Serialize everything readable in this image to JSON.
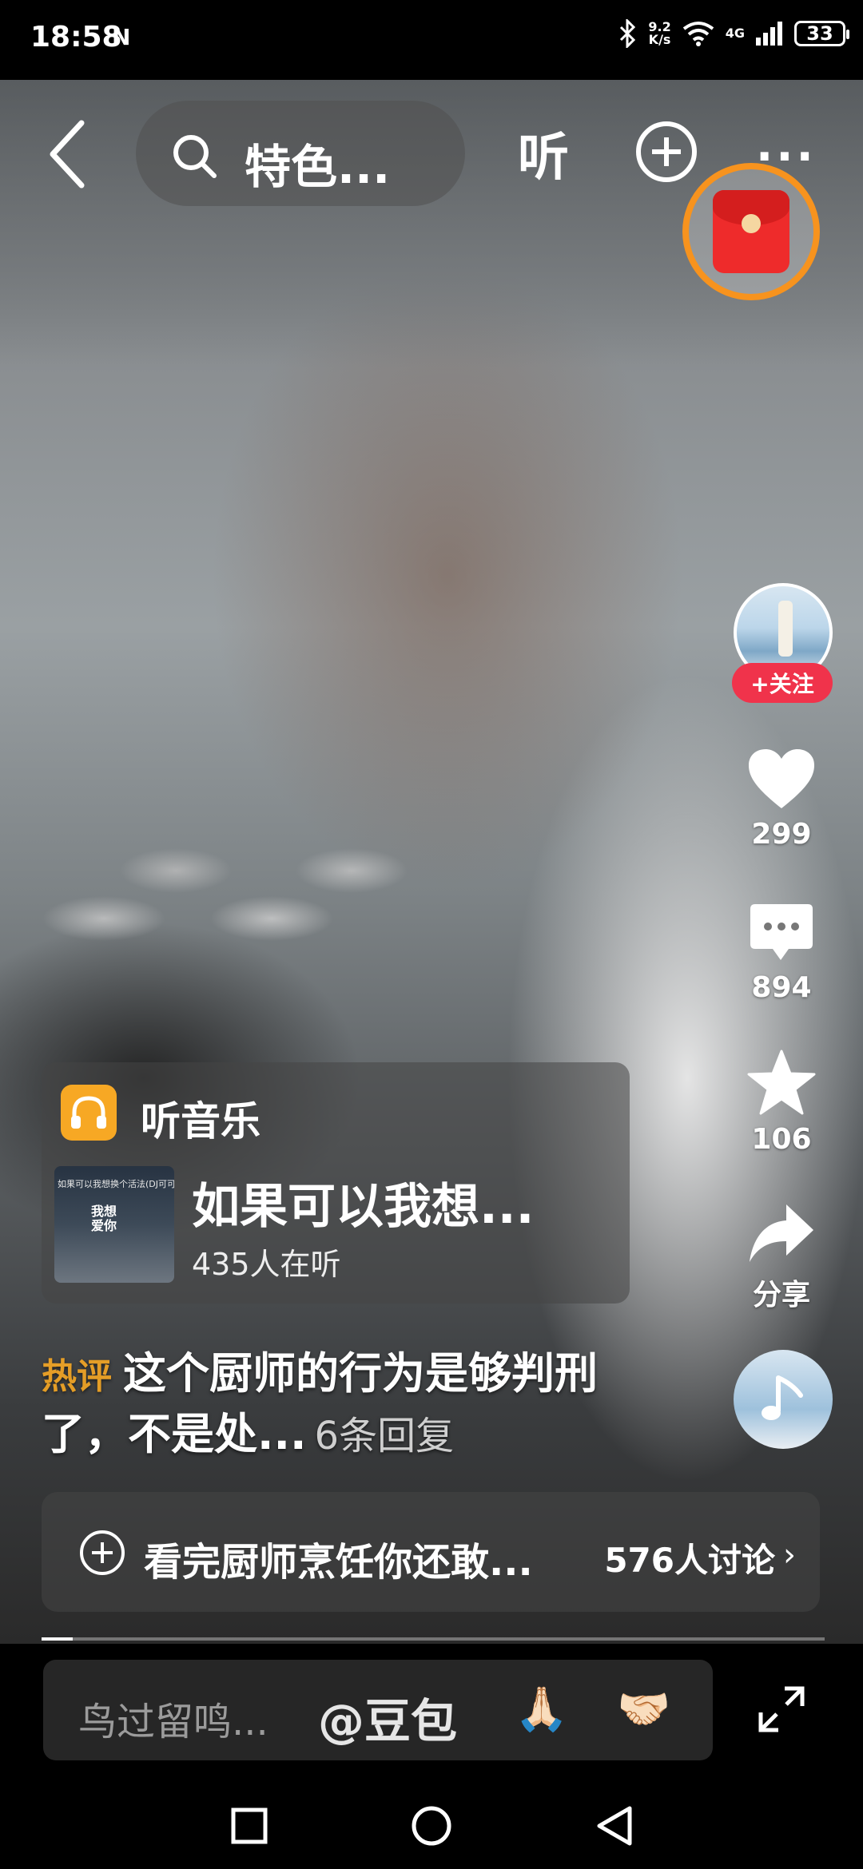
{
  "status_bar": {
    "time": "18:58",
    "nfc": "N",
    "network_speed_value": "9.2",
    "network_speed_unit": "K/s",
    "signal_label": "4G",
    "battery": "33"
  },
  "top_bar": {
    "search_text": "特色...",
    "listen_label": "听",
    "more_label": "..."
  },
  "actions": {
    "follow_label": "+关注",
    "like_count": "299",
    "comment_count": "894",
    "favorite_count": "106",
    "share_label": "分享"
  },
  "music_card": {
    "app_label": "听音乐",
    "song_title": "如果可以我想...",
    "listeners": "435人在听",
    "album_text_top": "如果可以我想换个活法(DJ可可版)",
    "album_text_center": "我想爱你"
  },
  "hot_comment": {
    "tag": "热评",
    "text": "这个厨师的行为是够判刑了，不是处...",
    "replies": "6条回复"
  },
  "topic": {
    "title": "看完厨师烹饪你还敢...",
    "discussion_count": "576人讨论"
  },
  "comment_bar": {
    "placeholder": "鸟过留鸣...",
    "mention": "@豆包",
    "emoji_1": "🙏🏻",
    "emoji_2": "🤝🏻"
  },
  "playback": {
    "progress_fraction": 0.04
  },
  "icons": [
    "back-icon",
    "search-icon",
    "add-icon",
    "red-packet-icon",
    "heart-icon",
    "comment-icon",
    "star-icon",
    "share-icon",
    "music-note-icon",
    "headphones-icon",
    "fullscreen-icon",
    "recents-icon",
    "home-icon",
    "back-nav-icon"
  ],
  "colors": {
    "accent_orange": "#f7a824",
    "follow_red": "#f0334b",
    "packet_ring": "#f7931e"
  }
}
